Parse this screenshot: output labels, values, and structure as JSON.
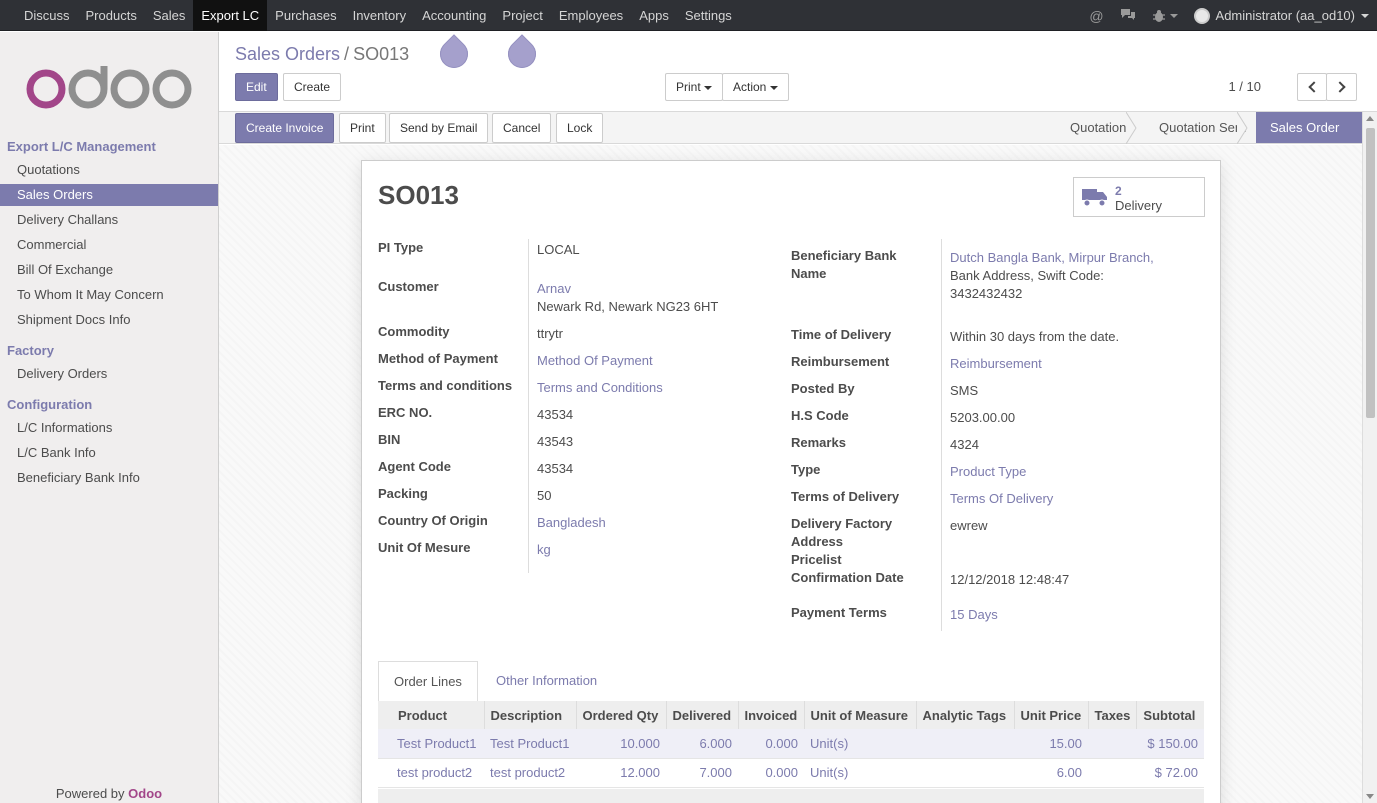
{
  "topbar": {
    "menu": [
      "Discuss",
      "Products",
      "Sales",
      "Export LC",
      "Purchases",
      "Inventory",
      "Accounting",
      "Project",
      "Employees",
      "Apps",
      "Settings"
    ],
    "active": "Export LC",
    "user": "Administrator (aa_od10)"
  },
  "sidebar": {
    "sections": [
      {
        "title": "Export L/C Management",
        "items": [
          "Quotations",
          "Sales Orders",
          "Delivery Challans",
          "Commercial",
          "Bill Of Exchange",
          "To Whom It May Concern",
          "Shipment Docs Info"
        ]
      },
      {
        "title": "Factory",
        "items": [
          "Delivery Orders"
        ]
      },
      {
        "title": "Configuration",
        "items": [
          "L/C Informations",
          "L/C Bank Info",
          "Beneficiary Bank Info"
        ]
      }
    ],
    "active_item": "Sales Orders",
    "powered_by": "Powered by",
    "powered_brand": "Odoo"
  },
  "breadcrumb": {
    "parent": "Sales Orders",
    "separator": "/",
    "current": "SO013"
  },
  "buttons": {
    "edit": "Edit",
    "create": "Create",
    "print": "Print",
    "action": "Action"
  },
  "pager": "1 / 10",
  "status_buttons": {
    "create_invoice": "Create Invoice",
    "print": "Print",
    "send_email": "Send by Email",
    "cancel": "Cancel",
    "lock": "Lock"
  },
  "stages": [
    "Quotation",
    "Quotation Sent",
    "Sales Order"
  ],
  "active_stage": "Sales Order",
  "form": {
    "title": "SO013",
    "smart_button": {
      "count": "2",
      "label": "Delivery"
    },
    "left": {
      "pi_type": {
        "label": "PI Type",
        "value": "LOCAL"
      },
      "customer": {
        "label": "Customer",
        "name": "Arnav",
        "address": "Newark Rd, Newark NG23 6HT"
      },
      "commodity": {
        "label": "Commodity",
        "value": "ttrytr"
      },
      "method_payment": {
        "label": "Method of Payment",
        "value": "Method Of Payment"
      },
      "terms": {
        "label": "Terms and conditions",
        "value": "Terms and Conditions"
      },
      "erc": {
        "label": "ERC NO.",
        "value": "43534"
      },
      "bin": {
        "label": "BIN",
        "value": "43543"
      },
      "agent": {
        "label": "Agent Code",
        "value": "43534"
      },
      "packing": {
        "label": "Packing",
        "value": "50"
      },
      "country": {
        "label": "Country Of Origin",
        "value": "Bangladesh"
      },
      "uom": {
        "label": "Unit Of Mesure",
        "value": "kg"
      }
    },
    "right": {
      "bank": {
        "label_line1": "Beneficiary Bank",
        "label_line2": "Name",
        "value_link": "Dutch Bangla Bank, Mirpur Branch,",
        "value_line2": "Bank Address, Swift Code:",
        "value_line3": "3432432432"
      },
      "time_delivery": {
        "label": "Time of Delivery",
        "value": "Within 30 days from the date."
      },
      "reimbursement": {
        "label": "Reimbursement",
        "value": "Reimbursement"
      },
      "posted_by": {
        "label": "Posted By",
        "value": "SMS"
      },
      "hs_code": {
        "label": "H.S Code",
        "value": "5203.00.00"
      },
      "remarks": {
        "label": "Remarks",
        "value": "4324"
      },
      "type": {
        "label": "Type",
        "value": "Product Type"
      },
      "terms_delivery": {
        "label": "Terms of Delivery",
        "value": "Terms Of Delivery"
      },
      "factory": {
        "label_line1": "Delivery Factory",
        "label_line2": "Address",
        "value": "ewrew"
      },
      "pricelist": {
        "label": "Pricelist"
      },
      "confirmation": {
        "label": "Confirmation Date",
        "value": "12/12/2018 12:48:47"
      },
      "payment_terms": {
        "label": "Payment Terms",
        "value": "15 Days"
      }
    }
  },
  "tabs": [
    "Order Lines",
    "Other Information"
  ],
  "table": {
    "headers": [
      "Product",
      "Description",
      "Ordered Qty",
      "Delivered",
      "Invoiced",
      "Unit of Measure",
      "Analytic Tags",
      "Unit Price",
      "Taxes",
      "Subtotal"
    ],
    "rows": [
      [
        "Test Product1",
        "Test Product1",
        "10.000",
        "6.000",
        "0.000",
        "Unit(s)",
        "",
        "15.00",
        "",
        "$ 150.00"
      ],
      [
        "test product2",
        "test product2",
        "12.000",
        "7.000",
        "0.000",
        "Unit(s)",
        "",
        "6.00",
        "",
        "$ 72.00"
      ]
    ]
  },
  "colors": {
    "accent": "#7c7bad",
    "topbar": "#2f3136",
    "brand": "#a24689"
  }
}
